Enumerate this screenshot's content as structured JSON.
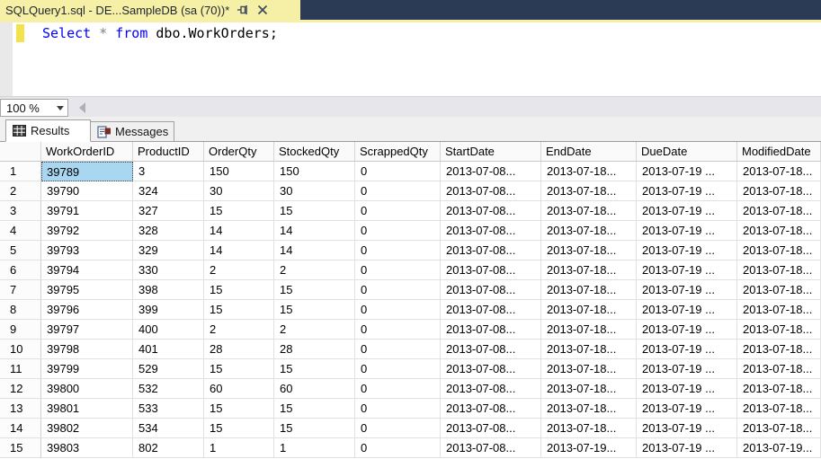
{
  "window": {
    "tab_title": "SQLQuery1.sql - DE...SampleDB (sa (70))*"
  },
  "editor": {
    "line1": {
      "keyword1": "Select",
      "operator": "*",
      "keyword2": "from",
      "object": "dbo.WorkOrders;"
    }
  },
  "zoom_control": {
    "value": "100 %"
  },
  "result_tabs": {
    "results_label": "Results",
    "messages_label": "Messages"
  },
  "grid": {
    "columns": [
      "",
      "WorkOrderID",
      "ProductID",
      "OrderQty",
      "StockedQty",
      "ScrappedQty",
      "StartDate",
      "EndDate",
      "DueDate",
      "ModifiedDate"
    ],
    "selected_cell": {
      "row": 0,
      "col": 1
    },
    "rows": [
      [
        "1",
        "39789",
        "3",
        "150",
        "150",
        "0",
        "2013-07-08...",
        "2013-07-18...",
        "2013-07-19 ...",
        "2013-07-18..."
      ],
      [
        "2",
        "39790",
        "324",
        "30",
        "30",
        "0",
        "2013-07-08...",
        "2013-07-18...",
        "2013-07-19 ...",
        "2013-07-18..."
      ],
      [
        "3",
        "39791",
        "327",
        "15",
        "15",
        "0",
        "2013-07-08...",
        "2013-07-18...",
        "2013-07-19 ...",
        "2013-07-18..."
      ],
      [
        "4",
        "39792",
        "328",
        "14",
        "14",
        "0",
        "2013-07-08...",
        "2013-07-18...",
        "2013-07-19 ...",
        "2013-07-18..."
      ],
      [
        "5",
        "39793",
        "329",
        "14",
        "14",
        "0",
        "2013-07-08...",
        "2013-07-18...",
        "2013-07-19 ...",
        "2013-07-18..."
      ],
      [
        "6",
        "39794",
        "330",
        "2",
        "2",
        "0",
        "2013-07-08...",
        "2013-07-18...",
        "2013-07-19 ...",
        "2013-07-18..."
      ],
      [
        "7",
        "39795",
        "398",
        "15",
        "15",
        "0",
        "2013-07-08...",
        "2013-07-18...",
        "2013-07-19 ...",
        "2013-07-18..."
      ],
      [
        "8",
        "39796",
        "399",
        "15",
        "15",
        "0",
        "2013-07-08...",
        "2013-07-18...",
        "2013-07-19 ...",
        "2013-07-18..."
      ],
      [
        "9",
        "39797",
        "400",
        "2",
        "2",
        "0",
        "2013-07-08...",
        "2013-07-18...",
        "2013-07-19 ...",
        "2013-07-18..."
      ],
      [
        "10",
        "39798",
        "401",
        "28",
        "28",
        "0",
        "2013-07-08...",
        "2013-07-18...",
        "2013-07-19 ...",
        "2013-07-18..."
      ],
      [
        "11",
        "39799",
        "529",
        "15",
        "15",
        "0",
        "2013-07-08...",
        "2013-07-18...",
        "2013-07-19 ...",
        "2013-07-18..."
      ],
      [
        "12",
        "39800",
        "532",
        "60",
        "60",
        "0",
        "2013-07-08...",
        "2013-07-18...",
        "2013-07-19 ...",
        "2013-07-18..."
      ],
      [
        "13",
        "39801",
        "533",
        "15",
        "15",
        "0",
        "2013-07-08...",
        "2013-07-18...",
        "2013-07-19 ...",
        "2013-07-18..."
      ],
      [
        "14",
        "39802",
        "534",
        "15",
        "15",
        "0",
        "2013-07-08...",
        "2013-07-18...",
        "2013-07-19 ...",
        "2013-07-18..."
      ],
      [
        "15",
        "39803",
        "802",
        "1",
        "1",
        "0",
        "2013-07-08...",
        "2013-07-19...",
        "2013-07-19 ...",
        "2013-07-19..."
      ]
    ]
  },
  "colors": {
    "tabstrip-bg": "#2C3B55",
    "active-tab-bg": "#F6EFA6",
    "change-bar": "#F2E24B",
    "kw-color": "#0000FF",
    "sel-bg": "#A9D6F0"
  }
}
